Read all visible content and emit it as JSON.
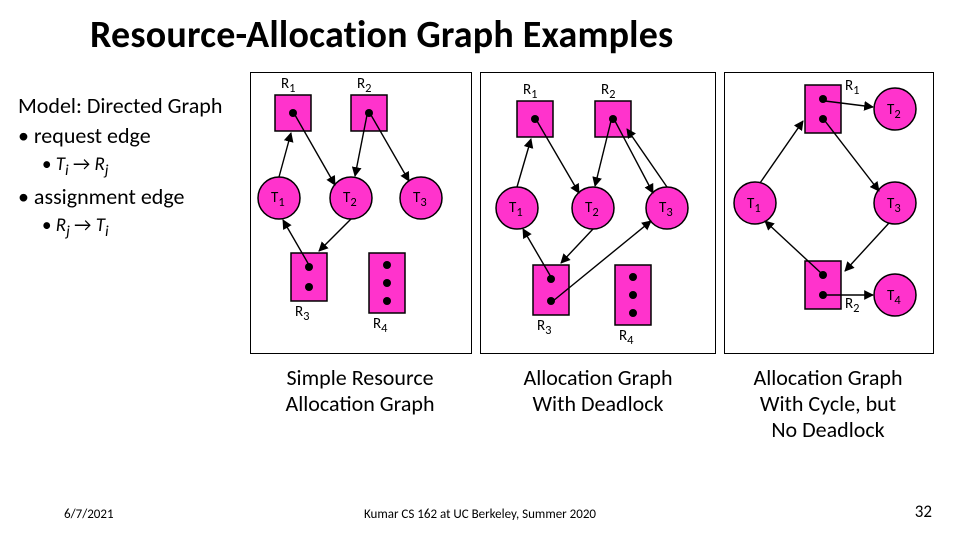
{
  "title": "Resource-Allocation Graph Examples",
  "model": {
    "line1": "Model: Directed Graph",
    "bullet1": "• request edge",
    "sub1_pre": "• ",
    "sub1_ti": "T",
    "sub1_i": "i",
    "sub1_arrow": " → ",
    "sub1_rj": "R",
    "sub1_j": "j",
    "bullet2": "• assignment edge",
    "sub2_pre": "• ",
    "sub2_rj": "R",
    "sub2_j": "j",
    "sub2_arrow": " → ",
    "sub2_ti": "T",
    "sub2_i": "i"
  },
  "labels": {
    "R1": "R",
    "R1s": "1",
    "R2": "R",
    "R2s": "2",
    "R3": "R",
    "R3s": "3",
    "R4": "R",
    "R4s": "4",
    "T1": "T",
    "T1s": "1",
    "T2": "T",
    "T2s": "2",
    "T3": "T",
    "T3s": "3",
    "T4": "T",
    "T4s": "4"
  },
  "captions": {
    "a1": "Simple Resource",
    "a2": "Allocation Graph",
    "b1": "Allocation Graph",
    "b2": "With Deadlock",
    "c1": "Allocation Graph",
    "c2": "With Cycle, but",
    "c3": "No Deadlock"
  },
  "footer": {
    "date": "6/7/2021",
    "center": "Kumar CS 162 at UC Berkeley, Summer 2020",
    "page": "32"
  },
  "chart_data": [
    {
      "type": "diagram",
      "name": "Simple Resource Allocation Graph",
      "processes": [
        "T1",
        "T2",
        "T3"
      ],
      "resources": {
        "R1": 1,
        "R2": 1,
        "R3": 2,
        "R4": 3
      },
      "request_edges": [
        [
          "T1",
          "R1"
        ],
        [
          "T2",
          "R3"
        ]
      ],
      "assignment_edges": [
        [
          "R1",
          "T2"
        ],
        [
          "R2",
          "T2"
        ],
        [
          "R2",
          "T3"
        ],
        [
          "R3",
          "T1"
        ]
      ]
    },
    {
      "type": "diagram",
      "name": "Allocation Graph With Deadlock",
      "processes": [
        "T1",
        "T2",
        "T3"
      ],
      "resources": {
        "R1": 1,
        "R2": 1,
        "R3": 2,
        "R4": 3
      },
      "request_edges": [
        [
          "T1",
          "R1"
        ],
        [
          "T2",
          "R3"
        ],
        [
          "T3",
          "R2"
        ]
      ],
      "assignment_edges": [
        [
          "R1",
          "T2"
        ],
        [
          "R2",
          "T2"
        ],
        [
          "R2",
          "T3"
        ],
        [
          "R3",
          "T1"
        ],
        [
          "R3",
          "T3"
        ]
      ]
    },
    {
      "type": "diagram",
      "name": "Allocation Graph With Cycle, but No Deadlock",
      "processes": [
        "T1",
        "T2",
        "T3",
        "T4"
      ],
      "resources": {
        "R1": 2,
        "R2": 2
      },
      "request_edges": [
        [
          "T1",
          "R1"
        ],
        [
          "T3",
          "R2"
        ]
      ],
      "assignment_edges": [
        [
          "R1",
          "T2"
        ],
        [
          "R1",
          "T3"
        ],
        [
          "R2",
          "T1"
        ],
        [
          "R2",
          "T4"
        ]
      ]
    }
  ]
}
